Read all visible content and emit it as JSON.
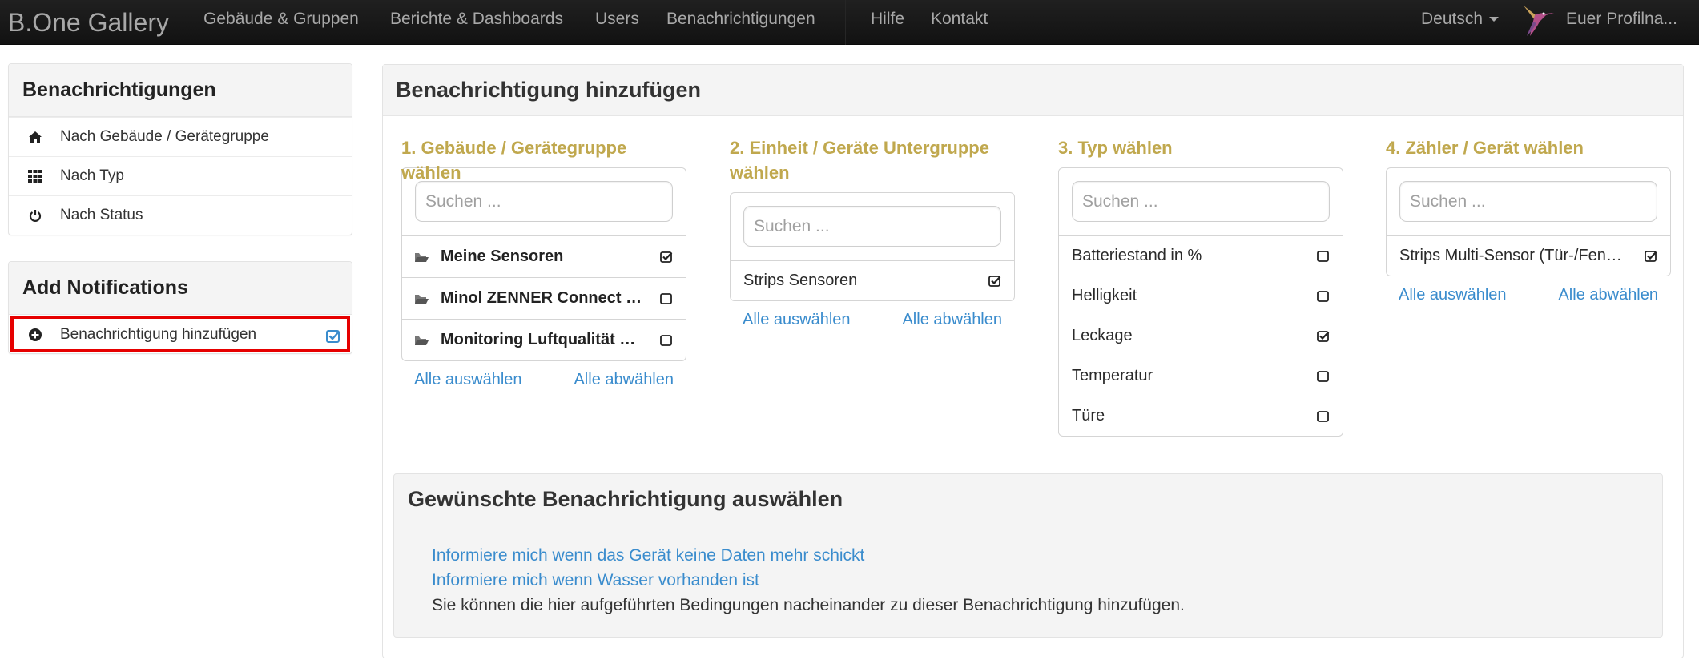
{
  "navbar": {
    "brand": "B.One Gallery",
    "items": [
      {
        "label": "Gebäude & Gruppen"
      },
      {
        "label": "Berichte & Dashboards"
      },
      {
        "label": "Users"
      },
      {
        "label": "Benachrichtigungen"
      }
    ],
    "right_items": [
      {
        "label": "Hilfe"
      },
      {
        "label": "Kontakt"
      }
    ],
    "language": "Deutsch",
    "profile": "Euer Profilna..."
  },
  "sidebar": {
    "panels": [
      {
        "title": "Benachrichtigungen",
        "items": [
          {
            "label": "Nach Gebäude / Gerätegruppe",
            "icon": "home-icon"
          },
          {
            "label": "Nach Typ",
            "icon": "grid-icon"
          },
          {
            "label": "Nach Status",
            "icon": "power-icon"
          }
        ]
      },
      {
        "title": "Add Notifications",
        "items": [
          {
            "label": "Benachrichtigung hinzufügen",
            "icon": "plus-circle-icon",
            "checked": true,
            "highlighted": true
          }
        ]
      }
    ]
  },
  "main": {
    "title": "Benachrichtigung hinzufügen",
    "columns": [
      {
        "title": "1. Gebäude / Gerätegruppe wählen",
        "search_placeholder": "Suchen ...",
        "items": [
          {
            "label": "Meine Sensoren",
            "checked": true
          },
          {
            "label": "Minol ZENNER Connect …",
            "checked": false
          },
          {
            "label": "Monitoring Luftqualität …",
            "checked": false
          }
        ],
        "select_all": "Alle auswählen",
        "deselect_all": "Alle abwählen"
      },
      {
        "title": "2. Einheit / Geräte Untergruppe wählen",
        "search_placeholder": "Suchen ...",
        "items": [
          {
            "label": "Strips Sensoren",
            "checked": true
          }
        ],
        "select_all": "Alle auswählen",
        "deselect_all": "Alle abwählen"
      },
      {
        "title": "3. Typ wählen",
        "search_placeholder": "Suchen ...",
        "items": [
          {
            "label": "Batteriestand in %",
            "checked": false
          },
          {
            "label": "Helligkeit",
            "checked": false
          },
          {
            "label": "Leckage",
            "checked": true
          },
          {
            "label": "Temperatur",
            "checked": false
          },
          {
            "label": "Türe",
            "checked": false
          }
        ]
      },
      {
        "title": "4. Zähler / Gerät wählen",
        "search_placeholder": "Suchen ...",
        "items": [
          {
            "label": "Strips Multi-Sensor (Tür-/Fen…",
            "checked": true
          }
        ],
        "select_all": "Alle auswählen",
        "deselect_all": "Alle abwählen"
      }
    ],
    "notification_select": {
      "title": "Gewünschte Benachrichtigung auswählen",
      "options": [
        {
          "label": "Informiere mich wenn das Gerät keine Daten mehr schickt"
        },
        {
          "label": "Informiere mich wenn Wasser vorhanden ist"
        }
      ],
      "hint": "Sie können die hier aufgeführten Bedingungen nacheinander zu dieser Benachrichtigung hinzufügen."
    }
  },
  "colors": {
    "accent_gold": "#c0a84e",
    "link_blue": "#3a8ccd",
    "highlight_red": "#e60000",
    "navbar_bg": "#1b1b1b"
  }
}
